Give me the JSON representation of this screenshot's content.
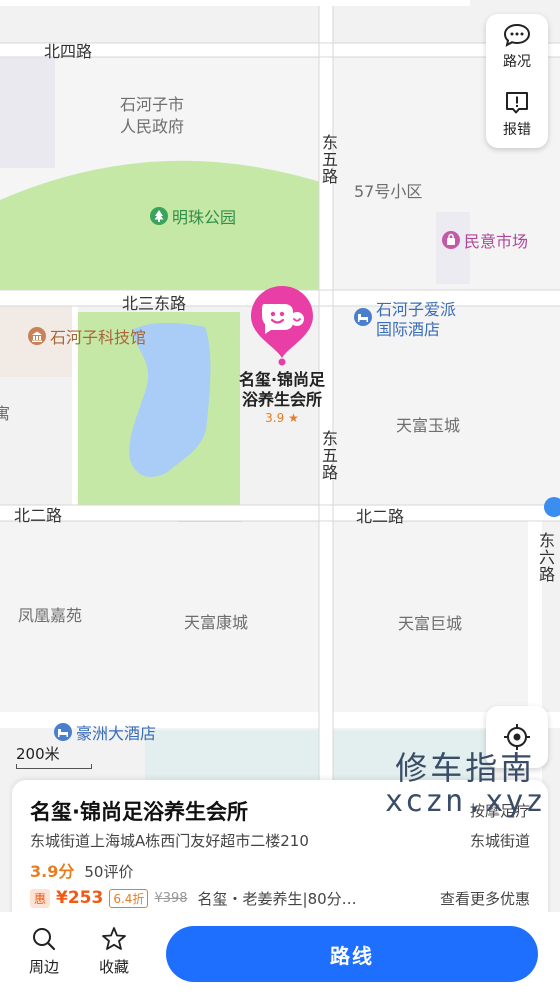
{
  "map": {
    "roads": {
      "bei_si_lu": "北四路",
      "bei_san_dong_lu": "北三东路",
      "bei_er_lu_left": "北二路",
      "bei_er_lu_right": "北二路",
      "dong_wu_lu_upper": "东五路",
      "dong_wu_lu_lower": "东五路",
      "dong_liu_lu": "东六路"
    },
    "areas": {
      "government_line1": "石河子市",
      "government_line2": "人民政府",
      "community_57": "57号小区",
      "tianfu_yucheng": "天富玉城",
      "fenghuang_jiayuan": "凤凰嘉苑",
      "tianfu_kangcheng": "天富康城",
      "tianfu_jucheng": "天富巨城",
      "edge_partial": "寓"
    },
    "pois": {
      "park": "明珠公园",
      "market": "民意市场",
      "museum": "石河子科技馆",
      "hotel_line1": "石河子爱派",
      "hotel_line2": "国际酒店",
      "haozhou_hotel": "豪洲大酒店"
    },
    "selected_marker": {
      "name_line1": "名玺·锦尚足",
      "name_line2": "浴养生会所",
      "rating": "3.9",
      "star": "★"
    },
    "scale_label": "200米"
  },
  "controls": {
    "traffic_label": "路况",
    "report_label": "报错",
    "traffic_icon": "chat-bubble-icon",
    "report_icon": "alert-icon",
    "locate_icon": "locate-icon"
  },
  "watermark": {
    "line1": "修车指南",
    "line2": "xczn.xyz"
  },
  "place_card": {
    "title": "名玺·锦尚足浴养生会所",
    "category": "按摩足疗",
    "address": "东城街道上海城A栋西门友好超市二楼210",
    "district": "东城街道",
    "score": "3.9分",
    "reviews": "50评价",
    "deal_badge": "惠",
    "deal_price": "¥253",
    "discount": "6.4折",
    "original_price": "¥398",
    "deal_desc": "名玺・老姜养生|80分…",
    "more_offers": "查看更多优惠"
  },
  "bottom_bar": {
    "nearby_label": "周边",
    "favorite_label": "收藏",
    "route_label": "路线",
    "nearby_icon": "search-icon",
    "favorite_icon": "star-icon"
  },
  "colors": {
    "accent": "#1f6fff",
    "marker": "#e83ea6",
    "park": "#c6e8a6",
    "water": "#a9cdf6",
    "price": "#f05a14",
    "rating": "#e67e22"
  }
}
